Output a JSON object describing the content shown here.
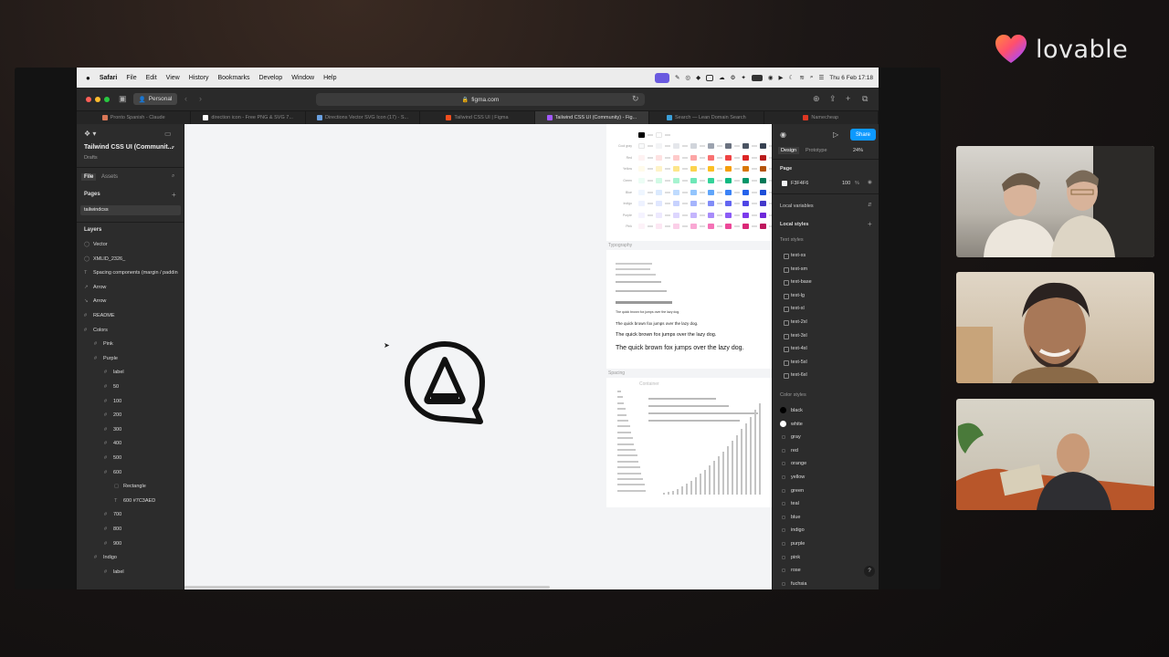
{
  "brand": {
    "name": "lovable"
  },
  "menubar": {
    "items": [
      "Safari",
      "File",
      "Edit",
      "View",
      "History",
      "Bookmarks",
      "Develop",
      "Window",
      "Help"
    ],
    "clock": "Thu 6 Feb 17:18"
  },
  "safari": {
    "profile": "Personal",
    "url": "figma.com",
    "tabs": [
      {
        "title": "Pronto Spanish - Claude",
        "active": false
      },
      {
        "title": "direction icon - Free PNG & SVG 7...",
        "active": false
      },
      {
        "title": "Directions Vector SVG Icon (17) - S...",
        "active": false
      },
      {
        "title": "Tailwind CSS UI | Figma",
        "active": false
      },
      {
        "title": "Tailwind CSS UI (Community) - Fig...",
        "active": true
      },
      {
        "title": "Search — Lean Domain Search",
        "active": false
      },
      {
        "title": "Namecheap",
        "active": false
      }
    ]
  },
  "figma_left": {
    "file_name": "Tailwind CSS UI (Communit...",
    "drafts": "Drafts",
    "tab_file": "File",
    "tab_assets": "Assets",
    "pages_label": "Pages",
    "page": "tailwindcss",
    "layers_label": "Layers",
    "layers": [
      {
        "glyph": "◯",
        "label": "Vector",
        "indent": 0
      },
      {
        "glyph": "◯",
        "label": "XMLID_2326_",
        "indent": 0
      },
      {
        "glyph": "T",
        "label": "Spacing components (margin / paddin",
        "indent": 0
      },
      {
        "glyph": "↗",
        "label": "Arrow",
        "indent": 0
      },
      {
        "glyph": "↘",
        "label": "Arrow",
        "indent": 0
      },
      {
        "glyph": "#",
        "label": "README",
        "indent": 0
      },
      {
        "glyph": "#",
        "label": "Colors",
        "indent": 0
      },
      {
        "glyph": "#",
        "label": "Pink",
        "indent": 1
      },
      {
        "glyph": "#",
        "label": "Purple",
        "indent": 1
      },
      {
        "glyph": "#",
        "label": "label",
        "indent": 2
      },
      {
        "glyph": "#",
        "label": "50",
        "indent": 2
      },
      {
        "glyph": "#",
        "label": "100",
        "indent": 2
      },
      {
        "glyph": "#",
        "label": "200",
        "indent": 2
      },
      {
        "glyph": "#",
        "label": "300",
        "indent": 2
      },
      {
        "glyph": "#",
        "label": "400",
        "indent": 2
      },
      {
        "glyph": "#",
        "label": "500",
        "indent": 2
      },
      {
        "glyph": "#",
        "label": "600",
        "indent": 2
      },
      {
        "glyph": "▢",
        "label": "Rectangle",
        "indent": 3
      },
      {
        "glyph": "T",
        "label": "600 #7C3AED",
        "indent": 3
      },
      {
        "glyph": "#",
        "label": "700",
        "indent": 2
      },
      {
        "glyph": "#",
        "label": "800",
        "indent": 2
      },
      {
        "glyph": "#",
        "label": "900",
        "indent": 2
      },
      {
        "glyph": "#",
        "label": "Indigo",
        "indent": 1
      },
      {
        "glyph": "#",
        "label": "label",
        "indent": 2
      }
    ]
  },
  "figma_right": {
    "tab_design": "Design",
    "tab_prototype": "Prototype",
    "zoom": "24%",
    "share": "Share",
    "page_label": "Page",
    "page_color": "F3F4F6",
    "page_opacity": "100",
    "page_opacity_unit": "%",
    "local_variables": "Local variables",
    "local_styles": "Local styles",
    "text_styles_label": "Text styles",
    "text_styles": [
      "text-xs",
      "text-sm",
      "text-base",
      "text-lg",
      "text-xl",
      "text-2xl",
      "text-3xl",
      "text-4xl",
      "text-5xl",
      "text-6xl"
    ],
    "color_styles_label": "Color styles",
    "color_styles": [
      {
        "name": "black",
        "color": "#000000"
      },
      {
        "name": "white",
        "color": "#ffffff"
      },
      {
        "name": "gray",
        "color": ""
      },
      {
        "name": "red",
        "color": ""
      },
      {
        "name": "orange",
        "color": ""
      },
      {
        "name": "yellow",
        "color": ""
      },
      {
        "name": "green",
        "color": ""
      },
      {
        "name": "teal",
        "color": ""
      },
      {
        "name": "blue",
        "color": ""
      },
      {
        "name": "indigo",
        "color": ""
      },
      {
        "name": "purple",
        "color": ""
      },
      {
        "name": "pink",
        "color": ""
      },
      {
        "name": "rose",
        "color": ""
      },
      {
        "name": "fuchsia",
        "color": ""
      }
    ]
  },
  "canvas": {
    "typography_label": "Typography",
    "spacing_label": "Spacing",
    "container_label": "Container",
    "sample_text": "The quick brown fox jumps over the lazy dog.",
    "palette_rows": [
      {
        "name": "",
        "colors": [
          "#000000",
          "#ffffff"
        ]
      },
      {
        "name": "Cool gray",
        "colors": [
          "#f9fafb",
          "#f3f4f6",
          "#e5e7eb",
          "#d1d5db",
          "#9ca3af",
          "#6b7280",
          "#4b5563",
          "#374151"
        ]
      },
      {
        "name": "Red",
        "colors": [
          "#fef2f2",
          "#fee2e2",
          "#fecaca",
          "#fca5a5",
          "#f87171",
          "#ef4444",
          "#dc2626",
          "#b91c1c"
        ]
      },
      {
        "name": "Yellow",
        "colors": [
          "#fffbeb",
          "#fef3c7",
          "#fde68a",
          "#fcd34d",
          "#fbbf24",
          "#f59e0b",
          "#d97706",
          "#b45309"
        ]
      },
      {
        "name": "Green",
        "colors": [
          "#ecfdf5",
          "#d1fae5",
          "#a7f3d0",
          "#6ee7b7",
          "#34d399",
          "#10b981",
          "#059669",
          "#047857"
        ]
      },
      {
        "name": "Blue",
        "colors": [
          "#eff6ff",
          "#dbeafe",
          "#bfdbfe",
          "#93c5fd",
          "#60a5fa",
          "#3b82f6",
          "#2563eb",
          "#1d4ed8"
        ]
      },
      {
        "name": "Indigo",
        "colors": [
          "#eef2ff",
          "#e0e7ff",
          "#c7d2fe",
          "#a5b4fc",
          "#818cf8",
          "#6366f1",
          "#4f46e5",
          "#4338ca"
        ]
      },
      {
        "name": "Purple",
        "colors": [
          "#f5f3ff",
          "#ede9fe",
          "#ddd6fe",
          "#c4b5fd",
          "#a78bfa",
          "#8b5cf6",
          "#7c3aed",
          "#6d28d9"
        ]
      },
      {
        "name": "Pink",
        "colors": [
          "#fdf2f8",
          "#fce7f3",
          "#fbcfe8",
          "#f9a8d4",
          "#f472b6",
          "#ec4899",
          "#db2777",
          "#be185d"
        ]
      }
    ]
  },
  "colors": {
    "accent": "#0d99ff",
    "figma_bg": "#2c2c2c",
    "canvas_bg": "#f3f4f6"
  }
}
